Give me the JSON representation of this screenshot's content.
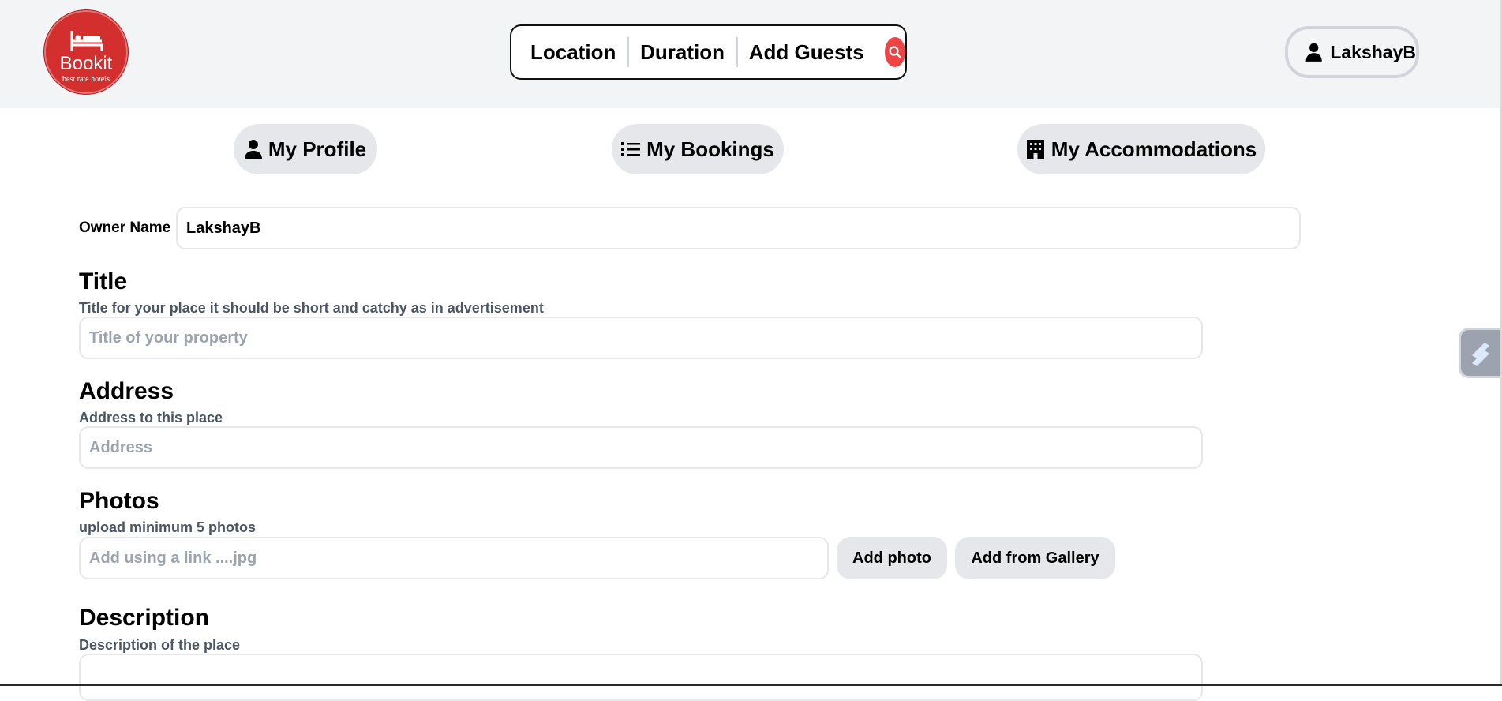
{
  "brand": {
    "name": "Bookit",
    "tagline": "best rate hotels",
    "color": "#d32f2f"
  },
  "search": {
    "location": "Location",
    "duration": "Duration",
    "guests": "Add Guests",
    "button_color": "#ef4444",
    "icon": "search-icon"
  },
  "user": {
    "name": "LakshayB",
    "icon": "user-icon"
  },
  "tabs": [
    {
      "label": "My Profile",
      "icon": "user-icon"
    },
    {
      "label": "My Bookings",
      "icon": "list-icon"
    },
    {
      "label": "My Accommodations",
      "icon": "building-icon"
    }
  ],
  "form": {
    "owner_label": "Owner Name",
    "owner_value": "LakshayB",
    "title": {
      "heading": "Title",
      "sub": "Title for your place it should be short and catchy as in advertisement",
      "placeholder": "Title of your property"
    },
    "address": {
      "heading": "Address",
      "sub": "Address to this place",
      "placeholder": "Address"
    },
    "photos": {
      "heading": "Photos",
      "sub": "upload minimum 5 photos",
      "placeholder": "Add using a link ....jpg",
      "add_photo": "Add photo",
      "add_gallery": "Add from Gallery"
    },
    "description": {
      "heading": "Description",
      "sub": "Description of the place"
    }
  }
}
